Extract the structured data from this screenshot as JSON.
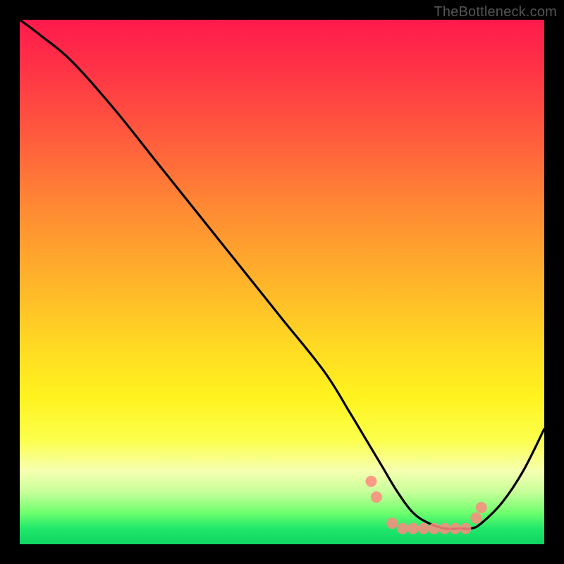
{
  "attribution": "TheBottleneck.com",
  "chart_data": {
    "type": "line",
    "title": "",
    "xlabel": "",
    "ylabel": "",
    "xlim": [
      0,
      100
    ],
    "ylim": [
      0,
      100
    ],
    "curve": {
      "name": "bottleneck-curve",
      "x": [
        0,
        4,
        10,
        18,
        26,
        34,
        42,
        50,
        58,
        63,
        66,
        69,
        72,
        75,
        78,
        81,
        84,
        86,
        88,
        92,
        96,
        100
      ],
      "y": [
        100,
        97,
        92,
        83,
        73,
        63,
        53,
        43,
        33,
        25,
        20,
        15,
        10,
        6,
        4,
        3,
        3,
        3,
        4,
        8,
        14,
        22
      ]
    },
    "markers": {
      "name": "highlight-dots",
      "color": "#ff8a80",
      "points": [
        {
          "x": 67,
          "y": 12
        },
        {
          "x": 68,
          "y": 9
        },
        {
          "x": 71,
          "y": 4
        },
        {
          "x": 73,
          "y": 3
        },
        {
          "x": 75,
          "y": 3
        },
        {
          "x": 77,
          "y": 3
        },
        {
          "x": 79,
          "y": 3
        },
        {
          "x": 81,
          "y": 3
        },
        {
          "x": 83,
          "y": 3
        },
        {
          "x": 85,
          "y": 3
        },
        {
          "x": 87,
          "y": 5
        },
        {
          "x": 88,
          "y": 7
        }
      ]
    }
  }
}
